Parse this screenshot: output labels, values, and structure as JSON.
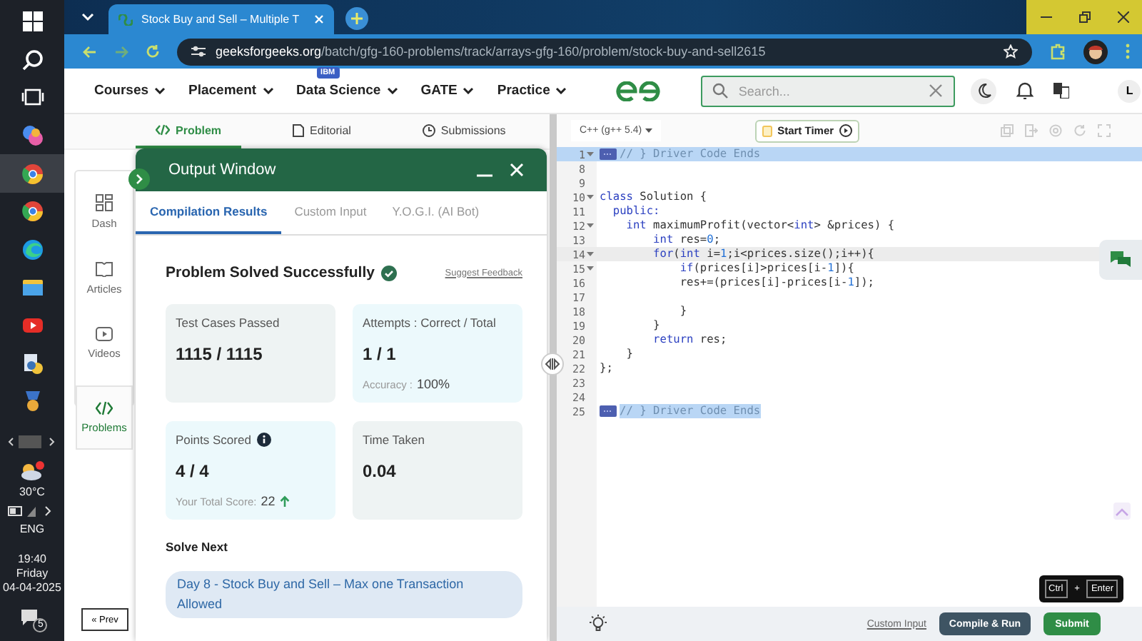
{
  "taskbar": {
    "apps": [
      {
        "selected": false
      },
      {
        "selected": false
      },
      {
        "selected": false
      },
      {
        "selected": false
      },
      {
        "selected": true
      },
      {
        "selected": false
      },
      {
        "selected": false
      },
      {
        "selected": false
      },
      {
        "selected": false
      },
      {
        "selected": false
      },
      {
        "selected": false
      }
    ],
    "weather": "30°C",
    "language": "ENG",
    "time": "19:40",
    "day": "Friday",
    "date": "04-04-2025",
    "notifications": "5"
  },
  "browser": {
    "tab_title": "Stock Buy and Sell – Multiple T",
    "url_host": "geeksforgeeks.org",
    "url_path": "/batch/gfg-160-problems/track/arrays-gfg-160/problem/stock-buy-and-sell2615"
  },
  "nav": {
    "items": [
      {
        "label": "Courses"
      },
      {
        "label": "Placement"
      },
      {
        "label": "Data Science",
        "badge": "IBM"
      },
      {
        "label": "GATE"
      },
      {
        "label": "Practice"
      }
    ],
    "search": {
      "placeholder": "Search..."
    },
    "avatar": "L"
  },
  "problem_tabs": [
    {
      "label": "Problem",
      "selected": true
    },
    {
      "label": "Editorial",
      "selected": false
    },
    {
      "label": "Submissions",
      "selected": false
    }
  ],
  "sidebar": {
    "items": [
      {
        "label": "Dash",
        "selected": false
      },
      {
        "label": "Articles",
        "selected": false
      },
      {
        "label": "Videos",
        "selected": false
      },
      {
        "label": "Problems",
        "selected": true
      }
    ]
  },
  "prev_button": "« Prev",
  "output_window": {
    "title": "Output Window",
    "tabs": [
      {
        "label": "Compilation Results",
        "selected": true
      },
      {
        "label": "Custom Input",
        "selected": false
      },
      {
        "label": "Y.O.G.I. (AI Bot)",
        "selected": false
      }
    ],
    "status": "Problem Solved Successfully",
    "feedback_link": "Suggest Feedback",
    "cards": [
      {
        "label": "Test Cases Passed",
        "value": "1115 / 1115",
        "color": "#eef3f3"
      },
      {
        "label": "Attempts : Correct / Total",
        "value": "1 / 1",
        "note_label": "Accuracy :",
        "note_value": "100%",
        "color": "#ecf9fc"
      },
      {
        "label": "Points Scored",
        "info": true,
        "value": "4 / 4",
        "note_label": "Your Total Score:",
        "note_value": "22",
        "trend_up": true,
        "color": "#ecf9fc"
      },
      {
        "label": "Time Taken",
        "value": "0.04",
        "color": "#eef3f3"
      }
    ],
    "solve_next": {
      "heading": "Solve Next",
      "item": "Day 8 - Stock Buy and Sell – Max one Transaction Allowed"
    }
  },
  "editor": {
    "language": "C++ (g++ 5.4)",
    "start_timer": "Start Timer",
    "lines": [
      {
        "num": "1",
        "foldable": true,
        "folded": true,
        "selected": true,
        "active": false,
        "tokens": [
          {
            "kind": "comment",
            "text": "// } Driver Code Ends"
          }
        ]
      },
      {
        "num": "8",
        "foldable": false,
        "folded": false,
        "selected": false,
        "active": false
      },
      {
        "num": "9",
        "foldable": false,
        "folded": false,
        "selected": false,
        "active": false
      },
      {
        "num": "10",
        "foldable": true,
        "folded": false,
        "selected": false,
        "active": false,
        "tokens": [
          {
            "kind": "kw",
            "text": "class"
          },
          {
            "kind": "plain",
            "text": " Solution {"
          }
        ]
      },
      {
        "num": "11",
        "foldable": false,
        "folded": false,
        "selected": false,
        "active": false,
        "tokens": [
          {
            "kind": "kw",
            "text": "  public:"
          }
        ]
      },
      {
        "num": "12",
        "foldable": true,
        "folded": false,
        "selected": false,
        "active": false,
        "tokens": [
          {
            "kind": "kw",
            "text": "    int"
          },
          {
            "kind": "plain",
            "text": " maximumProfit(vector<"
          },
          {
            "kind": "kw",
            "text": "int"
          },
          {
            "kind": "plain",
            "text": "> &prices) {"
          }
        ]
      },
      {
        "num": "13",
        "foldable": false,
        "folded": false,
        "selected": false,
        "active": false,
        "tokens": [
          {
            "kind": "kw",
            "text": "        int"
          },
          {
            "kind": "plain",
            "text": " res="
          },
          {
            "kind": "num",
            "text": "0"
          },
          {
            "kind": "plain",
            "text": ";"
          }
        ]
      },
      {
        "num": "14",
        "foldable": true,
        "folded": false,
        "selected": false,
        "active": true,
        "tokens": [
          {
            "kind": "kw",
            "text": "        for"
          },
          {
            "kind": "plain",
            "text": "("
          },
          {
            "kind": "kw",
            "text": "int"
          },
          {
            "kind": "plain",
            "text": " i="
          },
          {
            "kind": "num",
            "text": "1"
          },
          {
            "kind": "plain",
            "text": ";i<prices.size();i++){"
          }
        ]
      },
      {
        "num": "15",
        "foldable": true,
        "folded": false,
        "selected": false,
        "active": false,
        "tokens": [
          {
            "kind": "kw",
            "text": "            if"
          },
          {
            "kind": "plain",
            "text": "(prices[i]>prices[i-"
          },
          {
            "kind": "num",
            "text": "1"
          },
          {
            "kind": "plain",
            "text": "]){"
          }
        ]
      },
      {
        "num": "16",
        "foldable": false,
        "folded": false,
        "selected": false,
        "active": false,
        "tokens": [
          {
            "kind": "plain",
            "text": "            res+=(prices[i]-prices[i-"
          },
          {
            "kind": "num",
            "text": "1"
          },
          {
            "kind": "plain",
            "text": "]);"
          }
        ]
      },
      {
        "num": "17",
        "foldable": false,
        "folded": false,
        "selected": false,
        "active": false
      },
      {
        "num": "18",
        "foldable": false,
        "folded": false,
        "selected": false,
        "active": false,
        "tokens": [
          {
            "kind": "plain",
            "text": "            }"
          }
        ]
      },
      {
        "num": "19",
        "foldable": false,
        "folded": false,
        "selected": false,
        "active": false,
        "tokens": [
          {
            "kind": "plain",
            "text": "        }"
          }
        ]
      },
      {
        "num": "20",
        "foldable": false,
        "folded": false,
        "selected": false,
        "active": false,
        "tokens": [
          {
            "kind": "kw",
            "text": "        return"
          },
          {
            "kind": "plain",
            "text": " res;"
          }
        ]
      },
      {
        "num": "21",
        "foldable": false,
        "folded": false,
        "selected": false,
        "active": false,
        "tokens": [
          {
            "kind": "plain",
            "text": "    }"
          }
        ]
      },
      {
        "num": "22",
        "foldable": false,
        "folded": false,
        "selected": false,
        "active": false,
        "tokens": [
          {
            "kind": "plain",
            "text": "};"
          }
        ]
      },
      {
        "num": "23",
        "foldable": false,
        "folded": false,
        "selected": false,
        "active": false
      },
      {
        "num": "24",
        "foldable": false,
        "folded": false,
        "selected": false,
        "active": false
      },
      {
        "num": "25",
        "foldable": false,
        "folded": true,
        "selected": true,
        "active": false,
        "tokens": [
          {
            "kind": "comment",
            "text": "// } Driver Code Ends"
          }
        ]
      }
    ],
    "custom_input_link": "Custom Input",
    "compile_button": "Compile & Run",
    "submit_button": "Submit",
    "tooltip": {
      "keys": [
        "Ctrl",
        "Enter"
      ],
      "separator": "+"
    }
  }
}
